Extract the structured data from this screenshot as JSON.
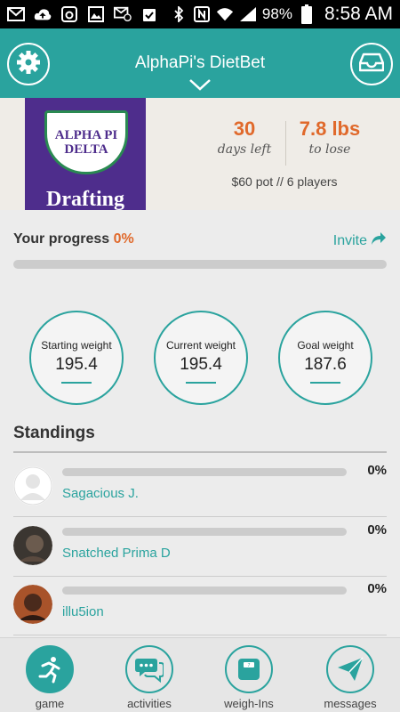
{
  "status_bar": {
    "battery": "98%",
    "time": "8:58 AM"
  },
  "header": {
    "title": "AlphaPi's DietBet"
  },
  "banner": {
    "image_line1": "ALPHA PI",
    "image_line2": "DELTA",
    "image_word": "Drafting",
    "days_value": "30",
    "days_label": "days left",
    "lose_value": "7.8 lbs",
    "lose_label": "to lose",
    "pot_text": "$60 pot // 6 players"
  },
  "progress": {
    "label": "Your progress",
    "percent_text": "0%",
    "percent_value": 0,
    "invite_label": "Invite"
  },
  "weights": [
    {
      "label": "Starting weight",
      "value": "195.4"
    },
    {
      "label": "Current weight",
      "value": "195.4"
    },
    {
      "label": "Goal weight",
      "value": "187.6"
    }
  ],
  "standings": {
    "title": "Standings",
    "players": [
      {
        "name": "Sagacious J.",
        "percent_text": "0%",
        "percent_value": 0
      },
      {
        "name": "Snatched Prima D",
        "percent_text": "0%",
        "percent_value": 0
      },
      {
        "name": "illu5ion",
        "percent_text": "0%",
        "percent_value": 0
      }
    ]
  },
  "nav": [
    {
      "label": "game",
      "icon": "runner-icon",
      "active": true
    },
    {
      "label": "activities",
      "icon": "chat-bubbles-icon",
      "active": false
    },
    {
      "label": "weigh-Ins",
      "icon": "scale-icon",
      "active": false
    },
    {
      "label": "messages",
      "icon": "paper-plane-icon",
      "active": false
    }
  ],
  "colors": {
    "accent": "#2aa39e",
    "highlight": "#e0692b"
  }
}
